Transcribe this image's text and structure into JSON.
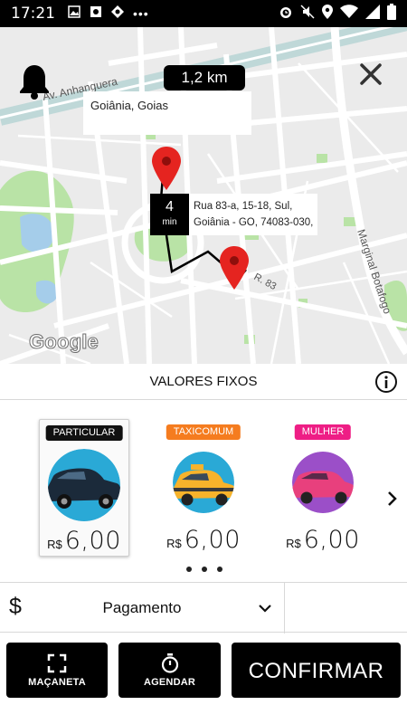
{
  "status_bar": {
    "time": "17:21",
    "left_icons": [
      "image-icon",
      "photo-icon",
      "location-app-icon",
      "more-dots-icon"
    ],
    "right_icons": [
      "alarm-icon",
      "mute-icon",
      "location-icon",
      "wifi-icon",
      "signal-icon",
      "battery-icon"
    ]
  },
  "map": {
    "distance": "1,2 km",
    "city_label": "Goiânia, Goias",
    "eta_value": "4",
    "eta_unit": "min",
    "address_line1": "Rua 83-a, 15-18, Sul,",
    "address_line2": "Goiânia - GO, 74083-030,",
    "street_labels": [
      "Av. Anhanguera",
      "Marginal Botafogo",
      "R. 83"
    ],
    "attribution": "Google",
    "pin_color": "#e52420",
    "route_color": "#000000"
  },
  "fixed_values": {
    "title": "VALORES FIXOS",
    "info_icon": "info-icon"
  },
  "cars": [
    {
      "tag": "PARTICULAR",
      "tag_color": "#111111",
      "currency": "R$",
      "price": "6,00",
      "selected": true,
      "avatar_bg": "#2aa9d6",
      "car_color": "#1b2a3a"
    },
    {
      "tag": "TAXICOMUM",
      "tag_color": "#f57c1f",
      "currency": "R$",
      "price": "6,00",
      "selected": false,
      "avatar_bg": "#2aa9d6",
      "car_color": "#f7b32b"
    },
    {
      "tag": "MULHER",
      "tag_color": "#ee1e85",
      "currency": "R$",
      "price": "6,00",
      "selected": false,
      "avatar_bg": "#9b4fc8",
      "car_color": "#e8407d"
    }
  ],
  "payment": {
    "label": "Pagamento",
    "icon": "$"
  },
  "buttons": {
    "macaneta": "MAÇANETA",
    "agendar": "AGENDAR",
    "confirmar": "CONFIRMAR"
  }
}
